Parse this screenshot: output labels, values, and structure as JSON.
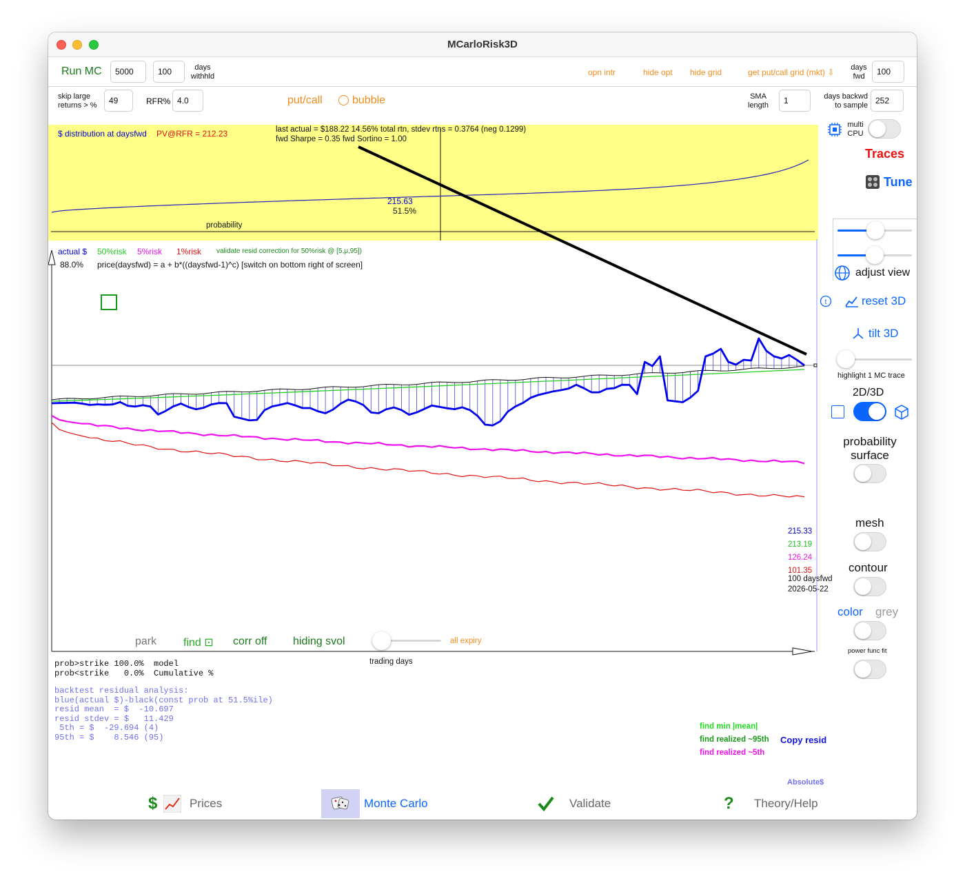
{
  "window": {
    "title": "MCarloRisk3D"
  },
  "toolbar1": {
    "run_label": "Run MC",
    "runs_value": "5000",
    "days_withheld_value": "100",
    "days_withheld_label_1": "days",
    "days_withheld_label_2": "withhld",
    "opn_intr": "opn intr",
    "hide_opt": "hide opt",
    "hide_grid": "hide grid",
    "get_grid": "get put/call grid (mkt) ⇩",
    "days_fwd_label_1": "days",
    "days_fwd_label_2": "fwd",
    "days_fwd_value": "100"
  },
  "toolbar2": {
    "skip_label_1": "skip large",
    "skip_label_2": "returns > %",
    "skip_value": "49",
    "rfr_label": "RFR%",
    "rfr_value": "4.0",
    "putcall": "put/call",
    "bubble": "bubble",
    "sma_label_1": "SMA",
    "sma_label_2": "length",
    "sma_value": "1",
    "backwd_label_1": "days backwd",
    "backwd_label_2": "to sample",
    "backwd_value": "252"
  },
  "dist_panel": {
    "title": "$ distribution at daysfwd",
    "pv": "PV@RFR = 212.23",
    "line1": "last actual = $188.22  14.56% total rtn, stdev rtns = 0.3764 (neg 0.1299)",
    "line2": "fwd Sharpe = 0.35 fwd Sortino = 1.00",
    "median_value": "215.63",
    "median_pct": "51.5%",
    "xlabel": "probability"
  },
  "main_chart": {
    "legend_actual": "actual $",
    "legend_50": "50%risk",
    "legend_5": "5%risk",
    "legend_1": "1%risk",
    "validate_note": "validate resid correction for 50%risk @ [5,μ,95])",
    "pct": "88.0%",
    "formula": "price(daysfwd) = a + b*((daysfwd-1)^c) [switch on bottom right of screen]",
    "end_actual": "215.33",
    "end_50": "213.19",
    "end_5": "126.24",
    "end_1": "101.35",
    "days_label": "100 daysfwd",
    "date_label": "2026-05-22",
    "xlabel": "trading days",
    "park": "park",
    "find": "find ⊡",
    "corr_off": "corr off",
    "hiding_svol": "hiding svol",
    "all_expiry": "all expiry",
    "colors": {
      "actual": "#0000ee",
      "risk50": "#22cc22",
      "risk5": "#ee11ee",
      "risk1": "#e01010"
    }
  },
  "chart_data": {
    "type": "line",
    "xlabel": "trading days",
    "series": [
      {
        "name": "actual $",
        "x": [
          1,
          100
        ],
        "values": [
          188.2,
          215.33
        ]
      },
      {
        "name": "50%risk",
        "x": [
          1,
          100
        ],
        "values": [
          188.2,
          213.19
        ]
      },
      {
        "name": "5%risk",
        "x": [
          1,
          100
        ],
        "values": [
          181.0,
          126.24
        ]
      },
      {
        "name": "1%risk",
        "x": [
          1,
          100
        ],
        "values": [
          178.0,
          101.35
        ]
      }
    ]
  },
  "stats": {
    "line1": "prob>strike 100.0%  model",
    "line2": "prob<strike   0.0%  Cumulative %",
    "line3": "backtest residual analysis:",
    "line4": "blue(actual $)-black(const prob at 51.5%ile)",
    "line5": "resid mean  = $  -10.697",
    "line6": "resid stdev = $   11.429",
    "line7": " 5th = $  -29.694 (4)",
    "line8": "95th = $    8.546 (95)"
  },
  "find_links": {
    "min_mean": "find min |mean|",
    "realized_95": "find realized ~95th",
    "copy_resid": "Copy resid",
    "realized_5": "find realized ~5th",
    "absolute": "Absolute$"
  },
  "sidebar": {
    "multi_cpu_1": "multi",
    "multi_cpu_2": "CPU",
    "traces": "Traces",
    "tune": "Tune",
    "adjust_view": "adjust view",
    "reset_3d": "reset 3D",
    "tilt_3d": "tilt 3D",
    "highlight": "highlight 1 MC trace",
    "twod_threed": "2D/3D",
    "prob_surface_1": "probability",
    "prob_surface_2": "surface",
    "mesh": "mesh",
    "contour": "contour",
    "color": "color",
    "grey": "grey",
    "power_fit": "power func fit"
  },
  "tabs": {
    "prices": "Prices",
    "monte_carlo": "Monte Carlo",
    "validate": "Validate",
    "theory": "Theory/Help"
  }
}
